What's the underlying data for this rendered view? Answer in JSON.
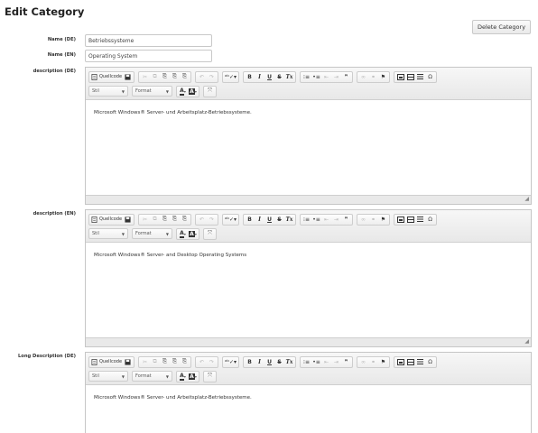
{
  "page": {
    "title": "Edit Category",
    "delete_label": "Delete Category"
  },
  "fields": {
    "name_de": {
      "label": "Name (DE)",
      "value": "Betriebssysteme"
    },
    "name_en": {
      "label": "Name (EN)",
      "value": "Operating System"
    },
    "description_de": {
      "label": "description (DE)",
      "content": "Microsoft Windows® Server- und Arbeitsplatz-Betriebssysteme."
    },
    "description_en": {
      "label": "description (EN)",
      "content": "Microsoft Windows® Server- and Desktop Operating Systems"
    },
    "long_description_de": {
      "label": "Long Description (DE)",
      "content": "Microsoft Windows® Server- und Arbeitsplatz-Betriebssysteme."
    }
  },
  "toolbar": {
    "source_label": "Quellcode",
    "style_label": "Stil",
    "format_label": "Format",
    "text_color_glyph": "A",
    "bg_color_glyph": "A",
    "icons": {
      "source": "source-icon",
      "save": "save-icon",
      "cut": "cut-icon",
      "copy": "copy-icon",
      "paste": "paste-icon",
      "paste_text": "paste-text-icon",
      "paste_word": "paste-word-icon",
      "undo": "undo-icon",
      "redo": "redo-icon",
      "spellcheck": "spellcheck-icon",
      "bold": "B",
      "italic": "I",
      "underline": "U",
      "strike": "S",
      "remove_format": "Tx",
      "numbered_list": "numbered-list-icon",
      "bullet_list": "bullet-list-icon",
      "outdent": "outdent-icon",
      "indent": "indent-icon",
      "blockquote": "blockquote-icon",
      "link": "link-icon",
      "unlink": "unlink-icon",
      "anchor": "flag-icon",
      "image": "image-icon",
      "table": "table-icon",
      "horizontal_rule": "horizontal-rule-icon",
      "special_char": "Ω",
      "maximize": "maximize-icon"
    }
  }
}
